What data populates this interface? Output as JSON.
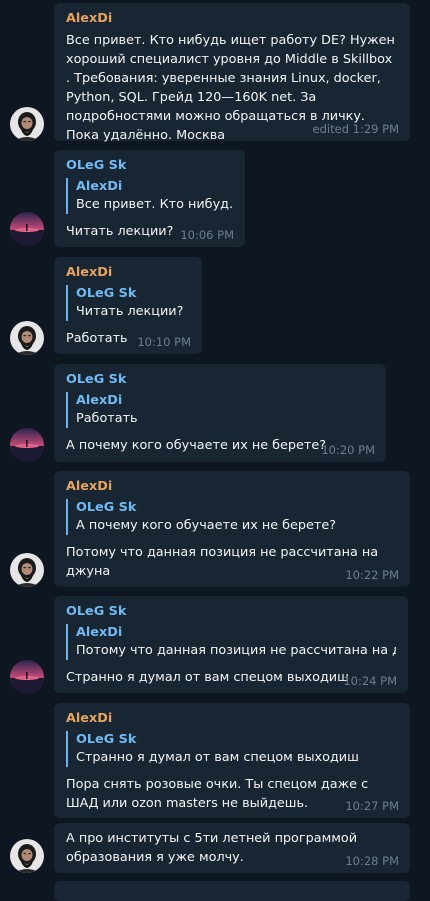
{
  "messages": [
    {
      "sender": "AlexDi",
      "text": "Все привет. Кто нибудь ищет работу DE? Нужен хороший специалист уровня до Middle в Skillbox . Требования: уверенные знания Linux, docker, Python, SQL. Грейд 120—160K net. За подробностями можно обращаться в личку. Пока удалённо. Москва",
      "time": "edited 1:29 PM"
    },
    {
      "sender": "OLeG Sk",
      "reply_name": "AlexDi",
      "reply_text": "Все привет. Кто нибуд...",
      "text": "Читать лекции?",
      "time": "10:06 PM"
    },
    {
      "sender": "AlexDi",
      "reply_name": "OLeG Sk",
      "reply_text": "Читать лекции?",
      "text": "Работать",
      "time": "10:10 PM"
    },
    {
      "sender": "OLeG Sk",
      "reply_name": "AlexDi",
      "reply_text": "Работать",
      "text": "А почему кого обучаете их не берете?",
      "time": "10:20 PM"
    },
    {
      "sender": "AlexDi",
      "reply_name": "OLeG Sk",
      "reply_text": "А почему кого обучаете их не берете?",
      "text": "Потому что данная позиция не рассчитана на джуна",
      "time": "10:22 PM"
    },
    {
      "sender": "OLeG Sk",
      "reply_name": "AlexDi",
      "reply_text": "Потому что данная позиция не рассчитана на д...",
      "text": "Странно я думал от вам спецом выходиш",
      "time": "10:24 PM"
    },
    {
      "sender": "AlexDi",
      "reply_name": "OLeG Sk",
      "reply_text": "Странно я думал от вам спецом выходиш",
      "text": "Пора снять розовые очки. Ты спецом даже с ШАД или ozon masters не выйдешь.",
      "time": "10:27 PM"
    },
    {
      "sender": "",
      "text": "А про институты с 5ти летней программой образования я уже молчу.",
      "time": "10:28 PM"
    }
  ],
  "colors": {
    "background": "#0e1621",
    "bubble": "#182533",
    "alex_name": "#e9a35c",
    "oleg_name": "#71baf2",
    "reply_bar": "#6ab2f2",
    "time": "#6d7f8f"
  },
  "icons": {
    "alex_avatar": "bearded-man-avatar",
    "oleg_avatar": "sunset-avatar"
  }
}
